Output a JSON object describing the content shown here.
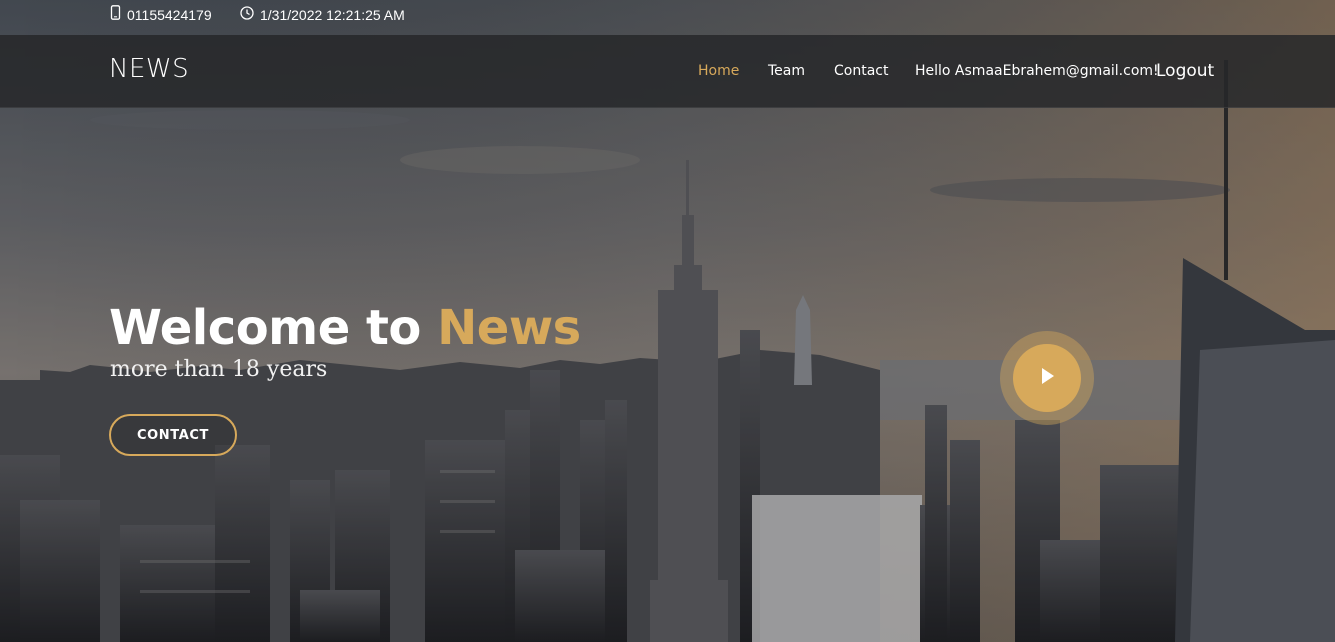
{
  "topbar": {
    "phone_icon": "mobile-phone-icon",
    "phone": "01155424179",
    "clock_icon": "clock-icon",
    "datetime": "1/31/2022 12:21:25 AM"
  },
  "navbar": {
    "brand": "NEWS",
    "links": {
      "home": "Home",
      "team": "Team",
      "contact": "Contact"
    },
    "greeting": "Hello AsmaaEbrahem@gmail.com!",
    "logout": "Logout"
  },
  "hero": {
    "title_prefix": "Welcome to ",
    "title_accent": "News",
    "subtitle": "more than 18 years",
    "cta_label": "CONTACT",
    "play_icon": "play-icon"
  },
  "colors": {
    "accent": "#d7a95b",
    "navbar_bg": "#26282a"
  }
}
